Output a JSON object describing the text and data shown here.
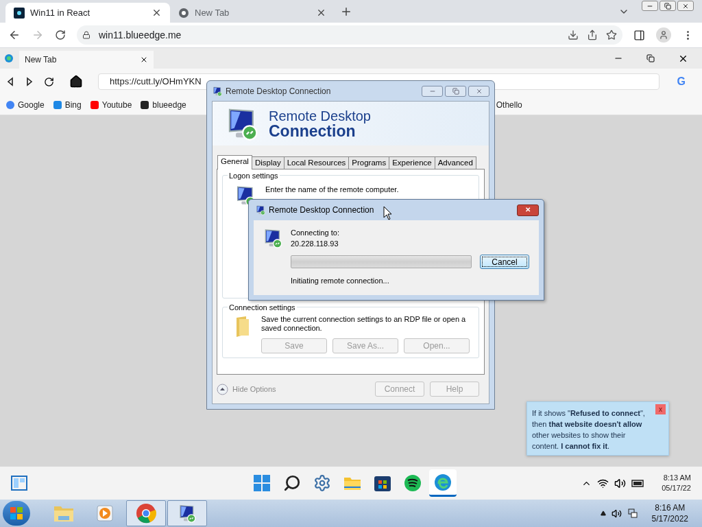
{
  "browser": {
    "tabs": [
      {
        "title": "Win11 in React",
        "selected": true
      },
      {
        "title": "New Tab",
        "selected": false
      }
    ],
    "address": "win11.blueedge.me"
  },
  "inner_browser": {
    "tab": "New Tab",
    "address": "https://cutt.ly/OHmYKN",
    "search_mark": "G",
    "bookmarks": [
      "Google",
      "Bing",
      "Youtube",
      "blueedge",
      "Othello"
    ]
  },
  "rdp_window": {
    "title": "Remote Desktop Connection",
    "heading": [
      "Remote Desktop",
      "Connection"
    ],
    "tabs": [
      {
        "label": "General",
        "selected": true
      },
      {
        "label": "Display",
        "selected": false
      },
      {
        "label": "Local Resources",
        "selected": false
      },
      {
        "label": "Programs",
        "selected": false
      },
      {
        "label": "Experience",
        "selected": false
      },
      {
        "label": "Advanced",
        "selected": false
      }
    ],
    "logon_settings": {
      "label": "Logon settings",
      "text": "Enter the name of the remote computer."
    },
    "connection_settings": {
      "label": "Connection settings",
      "text": "Save the current connection settings to an RDP file or open a saved connection.",
      "buttons": [
        {
          "label": "Save",
          "disabled": true
        },
        {
          "label": "Save As...",
          "disabled": true
        },
        {
          "label": "Open...",
          "disabled": true
        }
      ]
    },
    "hide_options": {
      "label": "Hide Options",
      "disabled": true
    },
    "buttons": [
      {
        "label": "Connect",
        "disabled": true
      },
      {
        "label": "Help",
        "disabled": true
      }
    ]
  },
  "connecting_dialog": {
    "title": "Remote Desktop Connection",
    "close": "✕",
    "label": "Connecting to:",
    "address": "20.228.118.93",
    "level": 0,
    "cancel": "Cancel",
    "status": "Initiating remote connection..."
  },
  "tooltip": {
    "text": "If it shows \"**Refused to connect**\", then **that website doesn't allow** other websites to show their content. **I cannot fix it**.",
    "close": "x"
  },
  "win11_taskbar": {
    "apps": [
      {
        "selected": false
      },
      {
        "selected": false
      },
      {
        "selected": false
      },
      {
        "selected": false
      },
      {
        "selected": false
      },
      {
        "selected": false
      },
      {
        "selected": true
      }
    ],
    "time": "8:13 AM",
    "date": "05/17/22"
  },
  "win7_taskbar": {
    "items": [
      {
        "selected": false
      },
      {
        "selected": false
      },
      {
        "selected": true
      },
      {
        "selected": true
      }
    ],
    "time": "8:16 AM",
    "date": "5/17/2022"
  }
}
